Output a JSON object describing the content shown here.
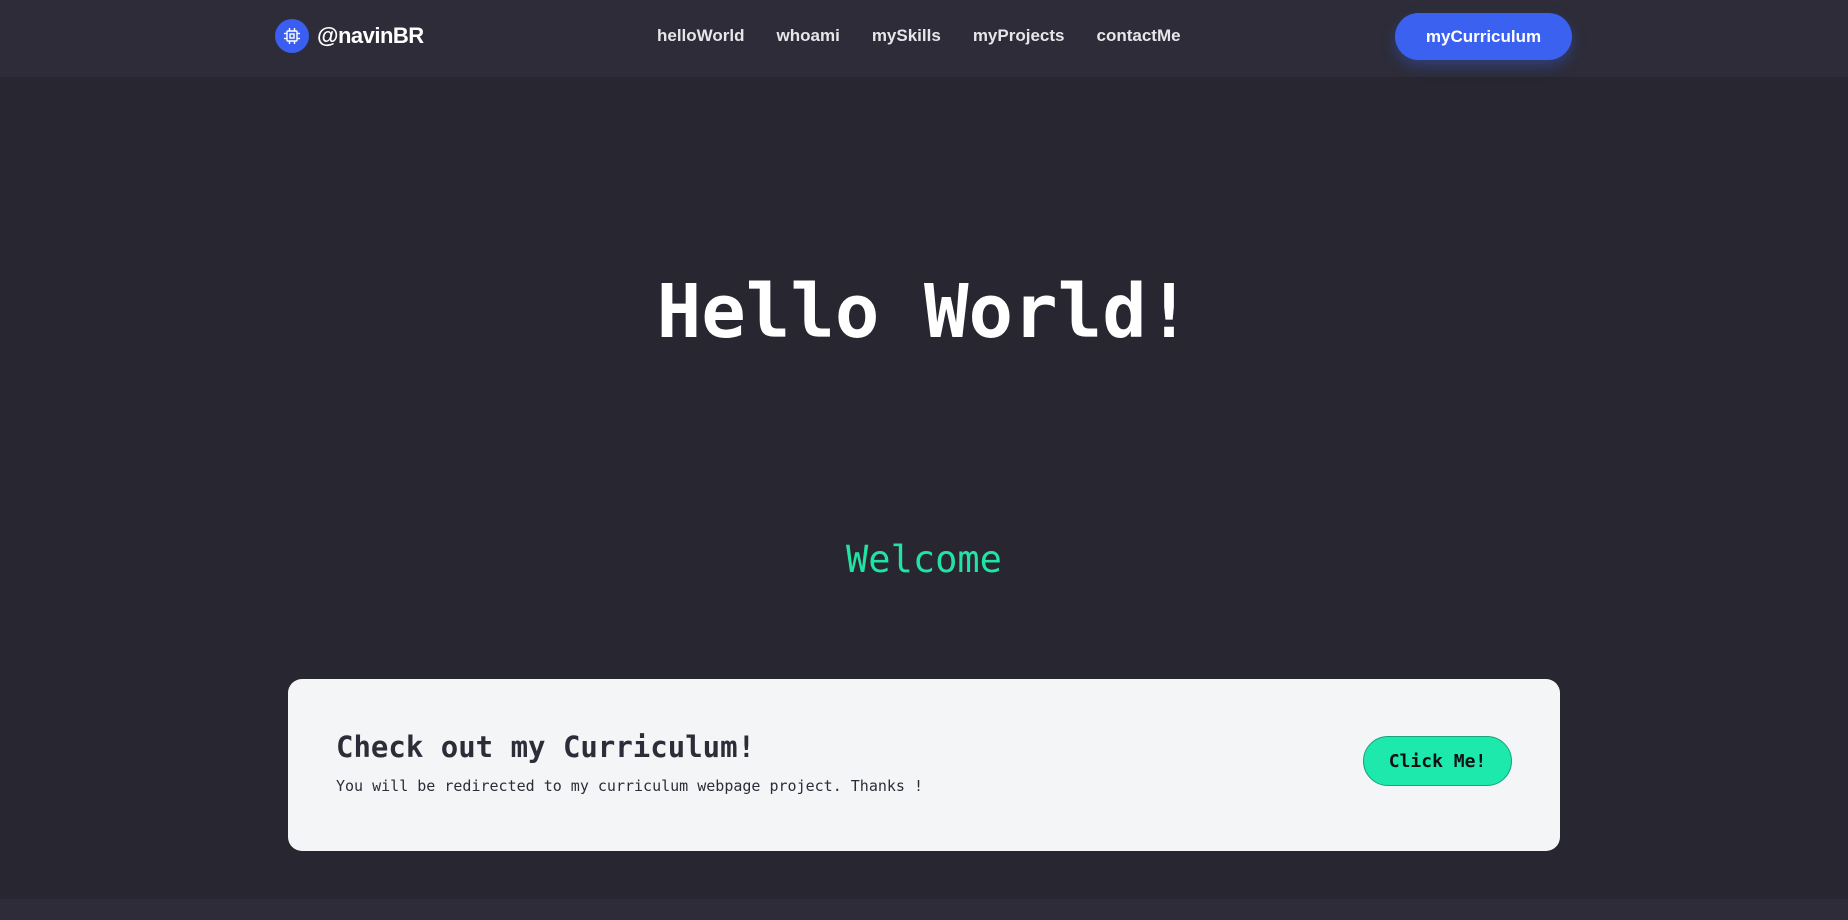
{
  "header": {
    "brand": {
      "icon": "cpu-chip-icon",
      "name": "@navinBR"
    },
    "nav": [
      {
        "label": "helloWorld"
      },
      {
        "label": "whoami"
      },
      {
        "label": "mySkills"
      },
      {
        "label": "myProjects"
      },
      {
        "label": "contactMe"
      }
    ],
    "cta_label": "myCurriculum"
  },
  "hero": {
    "title": "Hello World!",
    "subtitle": "Welcome"
  },
  "curriculum_card": {
    "title": "Check out my Curriculum!",
    "text": "You will be redirected to my curriculum webpage project. Thanks !",
    "button_label": "Click Me!"
  },
  "colors": {
    "background": "#272631",
    "navbar": "#2d2c38",
    "accent_blue": "#3a61ef",
    "accent_green": "#1de9ad",
    "card_bg": "#f4f5f7"
  }
}
